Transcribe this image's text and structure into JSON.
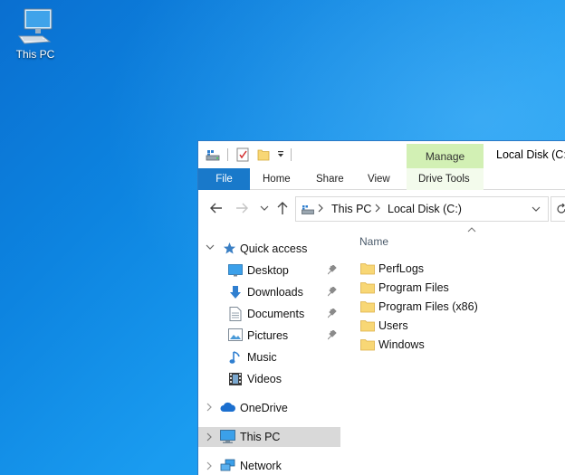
{
  "desktop": {
    "icons": [
      {
        "label": "This PC",
        "icon": "computer-icon"
      }
    ]
  },
  "window": {
    "title": "Local Disk (C:)",
    "quick_access_toolbar": [
      "properties-icon",
      "new-folder-icon",
      "customize-dropdown-icon"
    ],
    "contextual_tab_group": "Manage",
    "ribbon_tabs": [
      {
        "label": "File"
      },
      {
        "label": "Home"
      },
      {
        "label": "Share"
      },
      {
        "label": "View"
      },
      {
        "label": "Drive Tools"
      }
    ],
    "address_bar": {
      "root_icon": "drive-icon",
      "crumbs": [
        "This PC",
        "Local Disk (C:)"
      ]
    },
    "nav_pane": {
      "quick_access": {
        "label": "Quick access",
        "items": [
          {
            "label": "Desktop",
            "icon": "desktop-folder-icon",
            "pinned": true
          },
          {
            "label": "Downloads",
            "icon": "downloads-icon",
            "pinned": true
          },
          {
            "label": "Documents",
            "icon": "documents-icon",
            "pinned": true
          },
          {
            "label": "Pictures",
            "icon": "pictures-icon",
            "pinned": true
          },
          {
            "label": "Music",
            "icon": "music-icon",
            "pinned": false
          },
          {
            "label": "Videos",
            "icon": "videos-icon",
            "pinned": false
          }
        ]
      },
      "onedrive": {
        "label": "OneDrive",
        "icon": "cloud-icon"
      },
      "this_pc": {
        "label": "This PC",
        "icon": "computer-icon",
        "selected": true
      },
      "network": {
        "label": "Network",
        "icon": "network-icon"
      }
    },
    "file_list": {
      "column_header": "Name",
      "items": [
        {
          "name": "PerfLogs",
          "icon": "folder-icon"
        },
        {
          "name": "Program Files",
          "icon": "folder-icon"
        },
        {
          "name": "Program Files (x86)",
          "icon": "folder-icon"
        },
        {
          "name": "Users",
          "icon": "folder-icon"
        },
        {
          "name": "Windows",
          "icon": "folder-icon"
        }
      ]
    }
  },
  "colors": {
    "accent": "#1979ca",
    "manage_tab": "#d2f0b4",
    "folder": "#f8d775",
    "selection": "#d9d9d9"
  }
}
